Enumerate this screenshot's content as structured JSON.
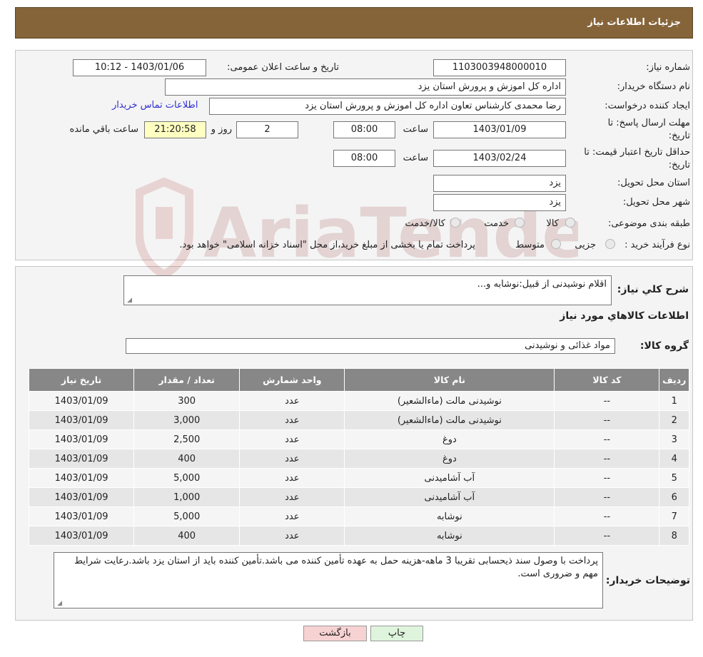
{
  "header": {
    "title": "جزئیات اطلاعات نیاز"
  },
  "form": {
    "need_number_label": "شماره نیاز:",
    "need_number": "1103003948000010",
    "announce_label": "تاریخ و ساعت اعلان عمومی:",
    "announce_value": "1403/01/06 - 10:12",
    "buyer_org_label": "نام دستگاه خریدار:",
    "buyer_org": "اداره کل اموزش و پرورش استان یزد",
    "creator_label": "ایجاد کننده درخواست:",
    "creator": "رضا محمدی کارشناس تعاون اداره کل اموزش و پرورش استان یزد",
    "contact_link": "اطلاعات تماس خریدار",
    "deadline_label_1": "مهلت ارسال پاسخ: تا",
    "deadline_label_2": "تاریخ:",
    "deadline_date": "1403/01/09",
    "time_label": "ساعت",
    "deadline_time": "08:00",
    "days_value": "2",
    "days_label": "روز و",
    "remaining_time": "21:20:58",
    "remaining_label": "ساعت باقي مانده",
    "validity_label_1": "حداقل تاریخ اعتبار قیمت: تا",
    "validity_label_2": "تاریخ:",
    "validity_date": "1403/02/24",
    "validity_time": "08:00",
    "province_label": "استان محل تحویل:",
    "province": "یزد",
    "city_label": "شهر محل تحویل:",
    "city": "یزد",
    "category_label": "طبقه بندی موضوعی:",
    "category_options": [
      "کالا",
      "خدمت",
      "کالا/خدمت"
    ],
    "process_label": "نوع فرآیند خرید :",
    "process_options": [
      "جزیی",
      "متوسط"
    ],
    "process_note": "پرداخت تمام یا بخشی از مبلغ خرید،از محل \"اسناد خزانه اسلامی\" خواهد بود."
  },
  "details": {
    "summary_label": "شرح کلي نياز:",
    "summary": "اقلام نوشیدنی از قبیل:نوشابه و...",
    "items_title": "اطلاعات کالاهاي مورد نياز",
    "group_label": "گروه کالا:",
    "group": "مواد غذائی و نوشیدنی"
  },
  "table": {
    "headers": [
      "رديف",
      "کد کالا",
      "نام کالا",
      "واحد شمارش",
      "تعداد / مقدار",
      "تاریخ نیاز"
    ],
    "rows": [
      [
        "1",
        "--",
        "نوشیدنی مالت (ماءالشعیر)",
        "عدد",
        "300",
        "1403/01/09"
      ],
      [
        "2",
        "--",
        "نوشیدنی مالت (ماءالشعیر)",
        "عدد",
        "3,000",
        "1403/01/09"
      ],
      [
        "3",
        "--",
        "دوغ",
        "عدد",
        "2,500",
        "1403/01/09"
      ],
      [
        "4",
        "--",
        "دوغ",
        "عدد",
        "400",
        "1403/01/09"
      ],
      [
        "5",
        "--",
        "آب آشامیدنی",
        "عدد",
        "5,000",
        "1403/01/09"
      ],
      [
        "6",
        "--",
        "آب آشامیدنی",
        "عدد",
        "1,000",
        "1403/01/09"
      ],
      [
        "7",
        "--",
        "نوشابه",
        "عدد",
        "5,000",
        "1403/01/09"
      ],
      [
        "8",
        "--",
        "نوشابه",
        "عدد",
        "400",
        "1403/01/09"
      ]
    ]
  },
  "notes": {
    "label": "توضیحات خریدار:",
    "text": "پرداخت با وصول سند ذیحسابی تقریبا 3 ماهه-هزینه حمل به عهده تأمین کننده می باشد.تأمین کننده باید از استان یزد باشد.رعایت شرایط مهم و ضروری است."
  },
  "buttons": {
    "print": "چاپ",
    "back": "بازگشت"
  },
  "watermark": {
    "text": "AriaTender.neT"
  },
  "colors": {
    "header": "#86643a",
    "table_header": "#878787",
    "remaining_bg": "#ffffc2",
    "back_button": "#f7d2d2",
    "print_button": "#dff4dc"
  }
}
